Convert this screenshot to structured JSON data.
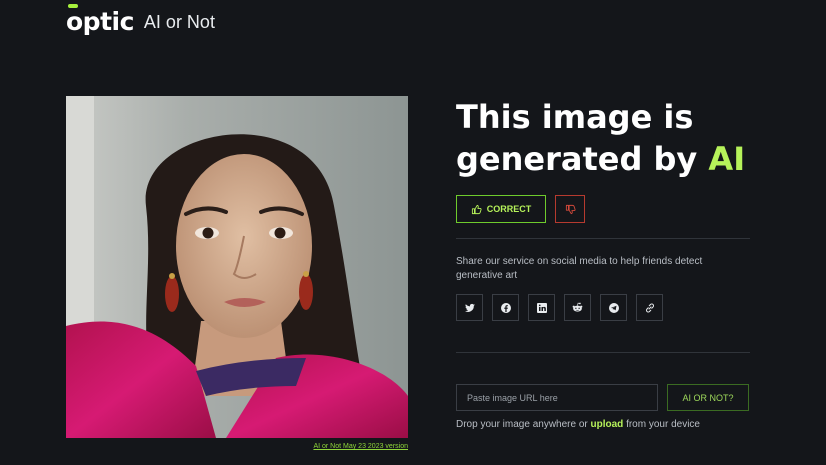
{
  "brand": {
    "logo": "optic",
    "app_name": "AI or Not"
  },
  "image": {
    "version_label": "AI or Not May 23 2023 version"
  },
  "result": {
    "title_prefix": "This image is generated by ",
    "title_highlight": "AI",
    "correct_label": "CORRECT"
  },
  "share": {
    "text": "Share our service on social media to help friends detect generative art",
    "networks": [
      "twitter-icon",
      "facebook-icon",
      "linkedin-icon",
      "reddit-icon",
      "telegram-icon",
      "link-icon"
    ]
  },
  "check": {
    "url_placeholder": "Paste image URL here",
    "submit_label": "AI OR NOT?",
    "drop_prefix": "Drop your image anywhere or ",
    "upload_label": "upload",
    "drop_suffix": " from your device"
  },
  "colors": {
    "background": "#14161a",
    "accent": "#b6f25a",
    "danger": "#b63a2f"
  }
}
